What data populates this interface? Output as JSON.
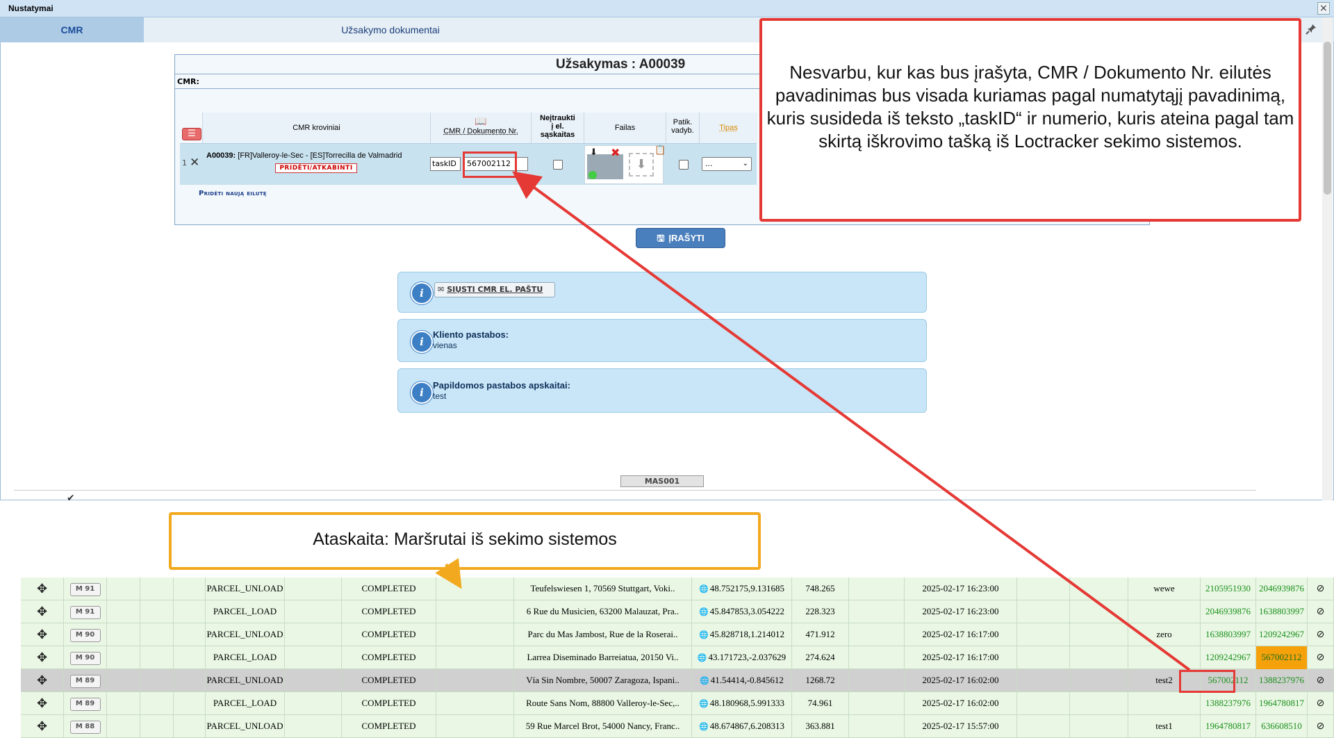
{
  "dialog": {
    "title": "Nustatymai",
    "close_glyph": "×",
    "tabs": [
      {
        "label": "CMR",
        "active": true
      },
      {
        "label": "Užsakymo dokumentai",
        "active": false
      }
    ]
  },
  "order": {
    "title": "Užsakymas : A00039",
    "cmr_label": "CMR:",
    "headers": {
      "cargo": "CMR kroviniai",
      "doc_nr": "CMR / Dokumento Nr.",
      "exclude_line1": "Neįtraukti",
      "exclude_line2": "į el.",
      "exclude_line3": "sąskaitas",
      "file": "Failas",
      "checked_line1": "Patik.",
      "checked_line2": "vadyb.",
      "type": "Tipas"
    },
    "row": {
      "number": "1",
      "order_code": "A00039:",
      "route": "[FR]Valleroy-le-Sec - [ES]Torrecilla de Valmadrid",
      "attach_label": "PRIDĖTI/ATKABINTI",
      "taskid_value": "taskID",
      "doc_nr_value": "567002112",
      "type_value": "..."
    },
    "add_row_label": "Pridėti naują eilutę",
    "save_label": "ĮRAŠYTI"
  },
  "info": {
    "email_btn": "SIŲSTI CMR EL. PAŠTU",
    "client_notes_label": "Kliento pastabos:",
    "client_notes_value": "vienas",
    "accounting_notes_label": "Papildomos pastabos apskaitai:",
    "accounting_notes_value": "test"
  },
  "mas_badge": "MAS001",
  "callouts": {
    "red": "Nesvarbu, kur kas bus įrašyta, CMR / Dokumento Nr. eilutės pavadinimas bus visada kuriamas pagal numatytąjį pavadinimą, kuris susideda iš teksto „taskID“ ir numerio, kuris ateina pagal tam skirtą iškrovimo tašką iš Loctracker sekimo sistemos.",
    "orange": "Ataskaita: Maršrutai iš sekimo sistemos"
  },
  "report": {
    "rows": [
      {
        "m": "M 91",
        "type": "PARCEL_UNLOAD",
        "status": "COMPLETED",
        "address": "Teufelswiesen 1, 70569 Stuttgart, Voki..",
        "coords": "48.752175,9.131685",
        "dist": "748.265",
        "time": "2025-02-17 16:23:00",
        "note": "wewe",
        "id1": "2105951930",
        "id2": "2046939876",
        "orange": false,
        "sel": false
      },
      {
        "m": "M 91",
        "type": "PARCEL_LOAD",
        "status": "COMPLETED",
        "address": "6 Rue du Musicien, 63200 Malauzat, Pra..",
        "coords": "45.847853,3.054222",
        "dist": "228.323",
        "time": "2025-02-17 16:23:00",
        "note": "",
        "id1": "2046939876",
        "id2": "1638803997",
        "orange": false,
        "sel": false
      },
      {
        "m": "M 90",
        "type": "PARCEL_UNLOAD",
        "status": "COMPLETED",
        "address": "Parc du Mas Jambost, Rue de la Roserai..",
        "coords": "45.828718,1.214012",
        "dist": "471.912",
        "time": "2025-02-17 16:17:00",
        "note": "zero",
        "id1": "1638803997",
        "id2": "1209242967",
        "orange": false,
        "sel": false
      },
      {
        "m": "M 90",
        "type": "PARCEL_LOAD",
        "status": "COMPLETED",
        "address": "Larrea Diseminado Barreiatua, 20150 Vi..",
        "coords": "43.171723,-2.037629",
        "dist": "274.624",
        "time": "2025-02-17 16:17:00",
        "note": "",
        "id1": "1209242967",
        "id2": "567002112",
        "orange": true,
        "sel": false
      },
      {
        "m": "M 89",
        "type": "PARCEL_UNLOAD",
        "status": "COMPLETED",
        "address": "Vía Sin Nombre, 50007 Zaragoza, Ispani..",
        "coords": "41.54414,-0.845612",
        "dist": "1268.72",
        "time": "2025-02-17 16:02:00",
        "note": "test2",
        "id1": "567002112",
        "id2": "1388237976",
        "orange": false,
        "sel": true
      },
      {
        "m": "M 89",
        "type": "PARCEL_LOAD",
        "status": "COMPLETED",
        "address": "Route Sans Nom, 88800 Valleroy-le-Sec,..",
        "coords": "48.180968,5.991333",
        "dist": "74.961",
        "time": "2025-02-17 16:02:00",
        "note": "",
        "id1": "1388237976",
        "id2": "1964780817",
        "orange": false,
        "sel": false
      },
      {
        "m": "M 88",
        "type": "PARCEL_UNLOAD",
        "status": "COMPLETED",
        "address": "59 Rue Marcel Brot, 54000 Nancy, Franc..",
        "coords": "48.674867,6.208313",
        "dist": "363.881",
        "time": "2025-02-17 15:57:00",
        "note": "test1",
        "id1": "1964780817",
        "id2": "636608510",
        "orange": false,
        "sel": false
      }
    ]
  }
}
